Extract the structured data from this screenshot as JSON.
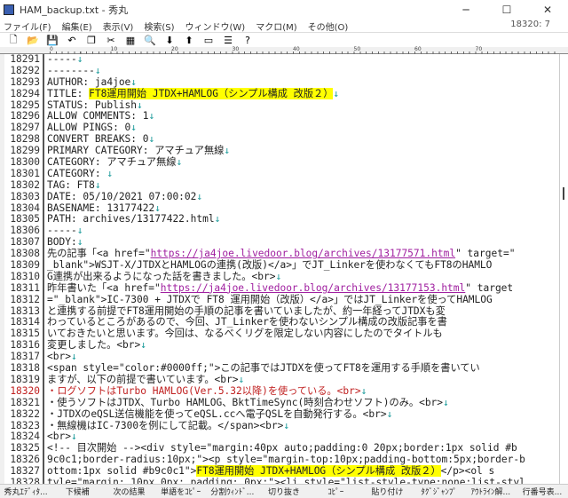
{
  "window": {
    "title": "HAM_backup.txt - 秀丸",
    "minimize": "─",
    "maximize": "☐",
    "close": "✕"
  },
  "menu": [
    "ファイル(F)",
    "編集(E)",
    "表示(V)",
    "検索(S)",
    "ウィンドウ(W)",
    "マクロ(M)",
    "その他(O)"
  ],
  "cursor_pos": "18320: 7",
  "toolbar": [
    {
      "name": "new-file-icon",
      "glyph": "🗋"
    },
    {
      "name": "open-folder-icon",
      "glyph": "📂"
    },
    {
      "name": "save-icon",
      "glyph": "💾"
    },
    {
      "name": "undo-icon",
      "glyph": "↶"
    },
    {
      "name": "copy-icon",
      "glyph": "❐"
    },
    {
      "name": "cut-icon",
      "glyph": "✂"
    },
    {
      "name": "paste-icon",
      "glyph": "▦"
    },
    {
      "name": "search-icon",
      "glyph": "🔍"
    },
    {
      "name": "search-down-icon",
      "glyph": "⬇"
    },
    {
      "name": "search-up-icon",
      "glyph": "⬆"
    },
    {
      "name": "window-icon",
      "glyph": "▭"
    },
    {
      "name": "split-icon",
      "glyph": "☰"
    },
    {
      "name": "help-icon",
      "glyph": "?"
    }
  ],
  "ruler": [
    "0",
    "10",
    "20",
    "30",
    "40",
    "50",
    "60",
    "70"
  ],
  "lines": [
    {
      "n": "18291",
      "s": [
        [
          "-----"
        ],
        [
          "↓",
          "eol"
        ]
      ]
    },
    {
      "n": "18292",
      "s": [
        [
          "--------"
        ],
        [
          "↓",
          "eol"
        ]
      ]
    },
    {
      "n": "18293",
      "s": [
        [
          "AUTHOR: ja4joe"
        ],
        [
          "↓",
          "eol"
        ]
      ]
    },
    {
      "n": "18294",
      "s": [
        [
          "TITLE: "
        ],
        [
          "FT8運用開始 JTDX+HAMLOG（シンプル構成 改版２）",
          "hl"
        ],
        [
          "↓",
          "eol"
        ]
      ]
    },
    {
      "n": "18295",
      "s": [
        [
          "STATUS: Publish"
        ],
        [
          "↓",
          "eol"
        ]
      ]
    },
    {
      "n": "18296",
      "s": [
        [
          "ALLOW COMMENTS: 1"
        ],
        [
          "↓",
          "eol"
        ]
      ]
    },
    {
      "n": "18297",
      "s": [
        [
          "ALLOW PINGS: 0"
        ],
        [
          "↓",
          "eol"
        ]
      ]
    },
    {
      "n": "18298",
      "s": [
        [
          "CONVERT BREAKS: 0"
        ],
        [
          "↓",
          "eol"
        ]
      ]
    },
    {
      "n": "18299",
      "s": [
        [
          "PRIMARY CATEGORY: アマチュア無線"
        ],
        [
          "↓",
          "eol"
        ]
      ]
    },
    {
      "n": "18300",
      "s": [
        [
          "CATEGORY: アマチュア無線"
        ],
        [
          "↓",
          "eol"
        ]
      ]
    },
    {
      "n": "18301",
      "s": [
        [
          "CATEGORY: "
        ],
        [
          "↓",
          "eol"
        ]
      ]
    },
    {
      "n": "18302",
      "s": [
        [
          "TAG: FT8"
        ],
        [
          "↓",
          "eol"
        ]
      ]
    },
    {
      "n": "18303",
      "s": [
        [
          "DATE: 05/10/2021 07:00:02"
        ],
        [
          "↓",
          "eol"
        ]
      ]
    },
    {
      "n": "18304",
      "s": [
        [
          "BASENAME: 13177422"
        ],
        [
          "↓",
          "eol"
        ]
      ]
    },
    {
      "n": "18305",
      "s": [
        [
          "PATH: archives/13177422.html"
        ],
        [
          "↓",
          "eol"
        ]
      ]
    },
    {
      "n": "18306",
      "s": [
        [
          "-----"
        ],
        [
          "↓",
          "eol"
        ]
      ]
    },
    {
      "n": "18307",
      "s": [
        [
          "BODY:"
        ],
        [
          "↓",
          "eol"
        ]
      ]
    },
    {
      "n": "18308",
      "s": [
        [
          "先の記事「<a href=\""
        ],
        [
          "https://ja4joe.livedoor.blog/archives/13177571.html",
          "link"
        ],
        [
          "\" target=\""
        ]
      ]
    },
    {
      "n": "18309",
      "s": [
        [
          "_blank\">WSJT-X/JTDXとHAMLOGの連携(改版)</a>」でJT_Linkerを使わなくてもFT8のHAMLO"
        ]
      ]
    },
    {
      "n": "18310",
      "s": [
        [
          "G連携が出来るようになった話を書きました。<br>"
        ],
        [
          "↓",
          "eol"
        ]
      ]
    },
    {
      "n": "18311",
      "s": [
        [
          "昨年書いた「<a href=\""
        ],
        [
          "https://ja4joe.livedoor.blog/archives/13177153.html",
          "link"
        ],
        [
          "\" target"
        ]
      ]
    },
    {
      "n": "18312",
      "s": [
        [
          "=\"_blank\">IC-7300 + JTDXで FT8 運用開始（改版）</a>」ではJT_Linkerを使ってHAMLOG"
        ]
      ]
    },
    {
      "n": "18313",
      "s": [
        [
          "と連携する前提でFT8運用開始の手順の記事を書いていましたが、約一年経ってJTDXも変"
        ]
      ]
    },
    {
      "n": "18314",
      "s": [
        [
          "わっているところがあるので、今回、JT_Linkerを使わないシンプル構成の改版記事を書"
        ]
      ]
    },
    {
      "n": "18315",
      "s": [
        [
          "いておきたいと思います。今回は、なるべくリグを限定しない内容にしたのでタイトルも"
        ]
      ]
    },
    {
      "n": "18316",
      "s": [
        [
          "変更しました。<br>"
        ],
        [
          "↓",
          "eol"
        ]
      ]
    },
    {
      "n": "18317",
      "s": [
        [
          "<br>"
        ],
        [
          "↓",
          "eol"
        ]
      ]
    },
    {
      "n": "18318",
      "s": [
        [
          "<span style=\"color:#0000ff;\">この記事ではJTDXを使ってFT8を運用する手順を書いてい"
        ]
      ]
    },
    {
      "n": "18319",
      "s": [
        [
          "ますが、以下の前提で書いています。<br>"
        ],
        [
          "↓",
          "eol"
        ]
      ]
    },
    {
      "n": "18320",
      "red": true,
      "s": [
        [
          "・ログソフトはTurbo HAMLOG(Ver.5.32以降)を使っている。<br>"
        ],
        [
          "↓",
          "eol"
        ]
      ]
    },
    {
      "n": "18321",
      "s": [
        [
          "・使うソフトはJTDX、Turbo HAMLOG、BktTimeSync(時刻合わせソフト)のみ。<br>"
        ],
        [
          "↓",
          "eol"
        ]
      ]
    },
    {
      "n": "18322",
      "s": [
        [
          "・JTDXのeQSL送信機能を使ってeQSL.ccへ電子QSLを自動発行する。<br>"
        ],
        [
          "↓",
          "eol"
        ]
      ]
    },
    {
      "n": "18323",
      "s": [
        [
          "・無線機はIC-7300を例にして記載。</span><br>"
        ],
        [
          "↓",
          "eol"
        ]
      ]
    },
    {
      "n": "18324",
      "s": [
        [
          "<br>"
        ],
        [
          "↓",
          "eol"
        ]
      ]
    },
    {
      "n": "18325",
      "s": [
        [
          "<!-- 目次開始 --><div style=\"margin:40px auto;padding:0 20px;border:1px solid #b"
        ]
      ]
    },
    {
      "n": "18326",
      "s": [
        [
          "9c0c1;border-radius:10px;\"><p style=\"margin-top:10px;padding-bottom:5px;border-b"
        ]
      ]
    },
    {
      "n": "18327",
      "s": [
        [
          "ottom:1px solid #b9c0c1\">"
        ],
        [
          "FT8運用開始 JTDX+HAMLOG（シンプル構成 改版２）",
          "hl"
        ],
        [
          "</p><ol s"
        ]
      ]
    },
    {
      "n": "18328",
      "s": [
        [
          "tyle=\"margin: 10px 0px; padding: 0px;\"><li style=\"list-style-type:none;list-styl"
        ]
      ]
    }
  ],
  "statusbar": [
    "秀丸ｴﾃﾞｨﾀ...",
    "下候補",
    "次の結果",
    "単語をｺﾋﾟｰ",
    "分割ｳｨﾝﾄﾞ...",
    "切り抜き",
    "ｺﾋﾟｰ",
    "貼り付け",
    "ﾀｸﾞｼﾞｬﾝﾌﾟ",
    "ｱｳﾄﾗｲﾝ解...",
    "行番号表..."
  ]
}
